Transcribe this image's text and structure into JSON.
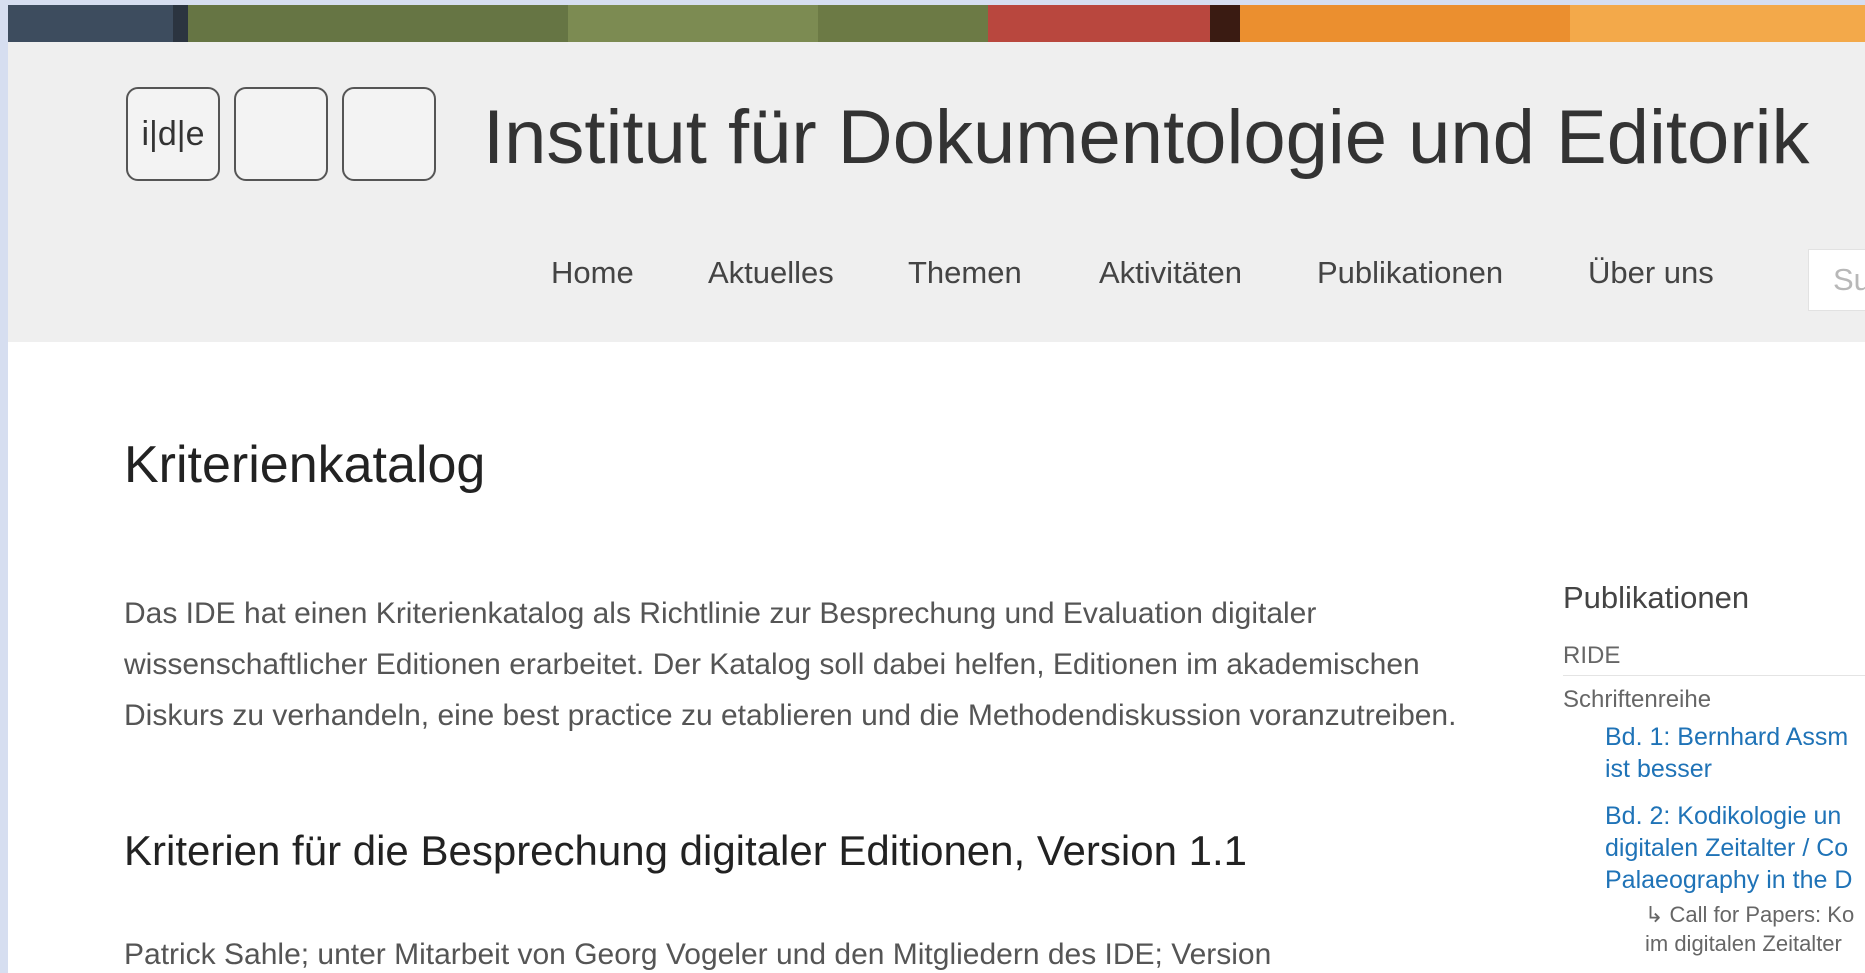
{
  "banner": {
    "colors": [
      "#3d4c5e",
      "#2b3440",
      "#667544",
      "#7c8b52",
      "#6c7a45",
      "#b9473e",
      "#3a1b12",
      "#eb8f2f",
      "#f3a94a"
    ]
  },
  "site": {
    "logo": {
      "box1": "i|d|e",
      "box2": "",
      "box3": ""
    },
    "title": "Institut für Dokumentologie und Editorik"
  },
  "nav": {
    "items": [
      "Home",
      "Aktuelles",
      "Themen",
      "Aktivitäten",
      "Publikationen",
      "Über uns"
    ],
    "search_placeholder": "Su"
  },
  "main": {
    "title": "Kriterienkatalog",
    "intro": "Das IDE hat einen Kriterienkatalog als Richtlinie zur Besprechung und Evaluation digitaler wissenschaftlicher Editionen erarbeitet. Der Katalog soll dabei helfen, Editionen im akademischen Diskurs zu verhandeln, eine best practice zu etablieren und die Methodendiskussion voranzutreiben.",
    "subheading": "Kriterien für die Besprechung digitaler Editionen, Version 1.1",
    "authors": "Patrick Sahle; unter Mitarbeit von Georg Vogeler und den Mitgliedern des IDE; Version"
  },
  "sidebar": {
    "title": "Publikationen",
    "item1": "RIDE",
    "item2": "Schriftenreihe",
    "bd1_line1": "Bd. 1: Bernhard Assm",
    "bd1_line2": "ist besser",
    "bd2_line1": "Bd. 2: Kodikologie un",
    "bd2_line2": "digitalen Zeitalter / Co",
    "bd2_line3": "Palaeography in the D",
    "cfp_line1": "↳ Call for Papers: Ko",
    "cfp_line2": "im digitalen Zeitalter"
  }
}
